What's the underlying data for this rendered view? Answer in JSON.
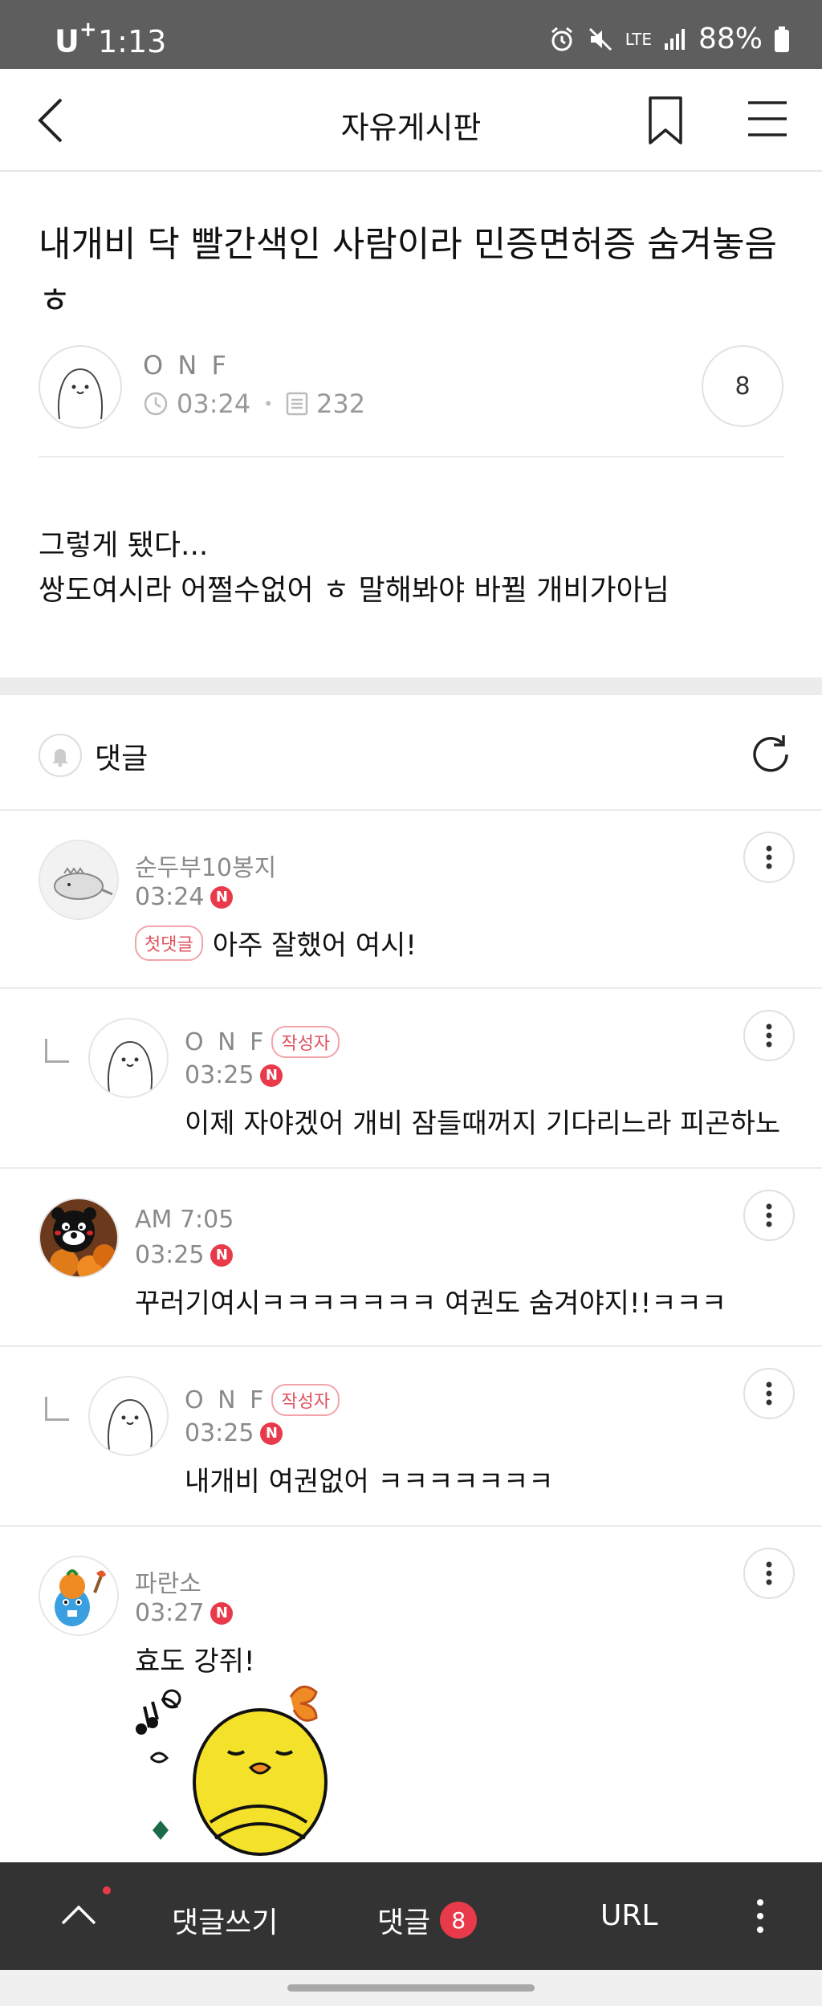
{
  "status_bar": {
    "carrier": "U",
    "carrier_plus": "+",
    "time": "1:13",
    "network": "LTE",
    "battery": "88%"
  },
  "header": {
    "title": "자유게시판"
  },
  "article": {
    "title": "내개비 닥 빨간색인 사람이라 민증면허증 숨겨놓음ㅎ",
    "author": "O N F",
    "time": "03:24",
    "views": "232",
    "comment_count": "8",
    "body_line1": "그렇게 됐다...",
    "body_line2": "쌍도여시라 어쩔수없어 ㅎ 말해봐야 바뀔 개비가아님"
  },
  "comments_section": {
    "label": "댓글"
  },
  "comments": [
    {
      "name": "순두부10봉지",
      "time": "03:24",
      "badge": "N",
      "first_badge": "첫댓글",
      "text": "아주 잘했어 여시!"
    },
    {
      "name": "O N F",
      "author_badge": "작성자",
      "time": "03:25",
      "badge": "N",
      "text": "이제 자야겠어 개비 잠들때꺼지 기다리느라 피곤하노"
    },
    {
      "name": "AM 7:05",
      "time": "03:25",
      "badge": "N",
      "text": "꾸러기여시ㅋㅋㅋㅋㅋㅋㅋ 여권도 숨겨야지!!ㅋㅋㅋ"
    },
    {
      "name": "O N F",
      "author_badge": "작성자",
      "time": "03:25",
      "badge": "N",
      "text": "내개비 여권없어 ㅋㅋㅋㅋㅋㅋㅋ"
    },
    {
      "name": "파란소",
      "time": "03:27",
      "badge": "N",
      "text": "효도 강쥐!"
    }
  ],
  "bottom_bar": {
    "write_label": "댓글쓰기",
    "comments_label": "댓글",
    "comments_count": "8",
    "url_label": "URL"
  },
  "colors": {
    "accent_red": "#e83a4a",
    "bottom_bar": "#333333",
    "status_bar": "#5e5e5e"
  }
}
